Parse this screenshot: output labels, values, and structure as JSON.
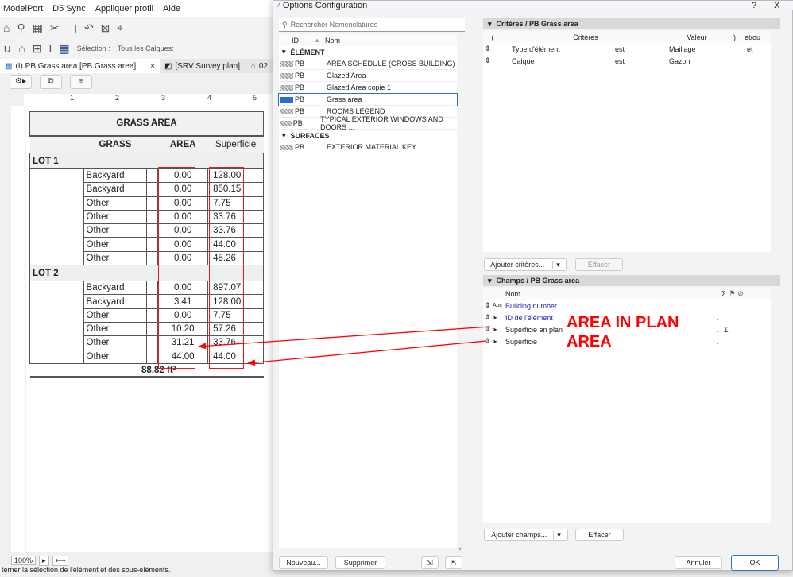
{
  "menu": [
    "ModelPort",
    "D5 Sync",
    "Appliquer profil",
    "Aide"
  ],
  "toolbar": {
    "selection_label": "Sélection :",
    "layers_label": "Tous les Calques:"
  },
  "tabs": [
    {
      "label": "(I) PB Grass area [PB Grass area]",
      "close": "×"
    },
    {
      "label": "[SRV Survey plan]"
    },
    {
      "label": "02"
    }
  ],
  "ruler": [
    "1",
    "2",
    "3",
    "4",
    "5"
  ],
  "schedule": {
    "title": "GRASS AREA",
    "headers": [
      "GRASS",
      "AREA",
      "Superficie"
    ],
    "lots": [
      {
        "name": "LOT 1",
        "rows": [
          [
            "Backyard",
            "0.00",
            "128.00"
          ],
          [
            "Backyard",
            "0.00",
            "850.15"
          ],
          [
            "Other",
            "0.00",
            "7.75"
          ],
          [
            "Other",
            "0.00",
            "33.76"
          ],
          [
            "Other",
            "0.00",
            "33.76"
          ],
          [
            "Other",
            "0.00",
            "44.00"
          ],
          [
            "Other",
            "0.00",
            "45.26"
          ]
        ]
      },
      {
        "name": "LOT 2",
        "rows": [
          [
            "Backyard",
            "0.00",
            "897.07"
          ],
          [
            "Backyard",
            "3.41",
            "128.00"
          ],
          [
            "Other",
            "0.00",
            "7.75"
          ],
          [
            "Other",
            "10.20",
            "57.26"
          ],
          [
            "Other",
            "31.21",
            "33.76"
          ],
          [
            "Other",
            "44.00",
            "44.00"
          ]
        ]
      }
    ],
    "total": "88.82 ft²"
  },
  "zoom": "100%",
  "status": "terner la sélection de l'élément et des sous-éléments.",
  "dialog": {
    "title": "Options Configuration",
    "help": "?",
    "close": "X",
    "search_placeholder": "Rechercher Nomenclatures",
    "list_headers": {
      "id": "ID",
      "nom": "Nom"
    },
    "groups": [
      {
        "name": "ÉLÉMENT",
        "items": [
          {
            "id": "PB",
            "name": "AREA SCHEDULE (GROSS BUILDING)"
          },
          {
            "id": "PB",
            "name": "Glazed Area"
          },
          {
            "id": "PB",
            "name": "Glazed Area copie 1"
          },
          {
            "id": "PB",
            "name": "Grass area",
            "selected": true
          },
          {
            "id": "PB",
            "name": "ROOMS LEGEND"
          },
          {
            "id": "PB",
            "name": "TYPICAL EXTERIOR WINDOWS AND DOORS ..."
          }
        ]
      },
      {
        "name": "SURFACES",
        "items": [
          {
            "id": "PB",
            "name": "EXTERIOR MATERIAL KEY"
          }
        ]
      }
    ],
    "criteria": {
      "header": "Critères / PB Grass area",
      "cols": [
        "(",
        "Critères",
        "Valeur",
        ")",
        "et/ou"
      ],
      "rows": [
        {
          "crit": "Type d'élément",
          "op": "est",
          "val": "Maillage",
          "andor": "et"
        },
        {
          "crit": "Calque",
          "op": "est",
          "val": "Gazon",
          "andor": ""
        }
      ],
      "add": "Ajouter critères...",
      "clear": "Effacer"
    },
    "fields": {
      "header": "Champs / PB Grass area",
      "col": "Nom",
      "col_icons": "↓ Σ",
      "rows": [
        {
          "icon": "Abc",
          "name": "Building number",
          "sort": "↓",
          "sum": ""
        },
        {
          "icon": "cursor",
          "name": "ID de l'élément",
          "sort": "↓",
          "sum": ""
        },
        {
          "icon": "cursor",
          "name": "Superficie en plan",
          "sort": "↓",
          "sum": "Σ"
        },
        {
          "icon": "cursor",
          "name": "Superficie",
          "sort": "↓",
          "sum": ""
        }
      ],
      "add": "Ajouter champs...",
      "clear": "Effacer"
    },
    "buttons": {
      "new": "Nouveau...",
      "delete": "Supprimer",
      "cancel": "Annuler",
      "ok": "OK"
    }
  },
  "annotations": {
    "line1": "AREA IN PLAN",
    "line2": "AREA",
    "color": "#ff0000"
  }
}
